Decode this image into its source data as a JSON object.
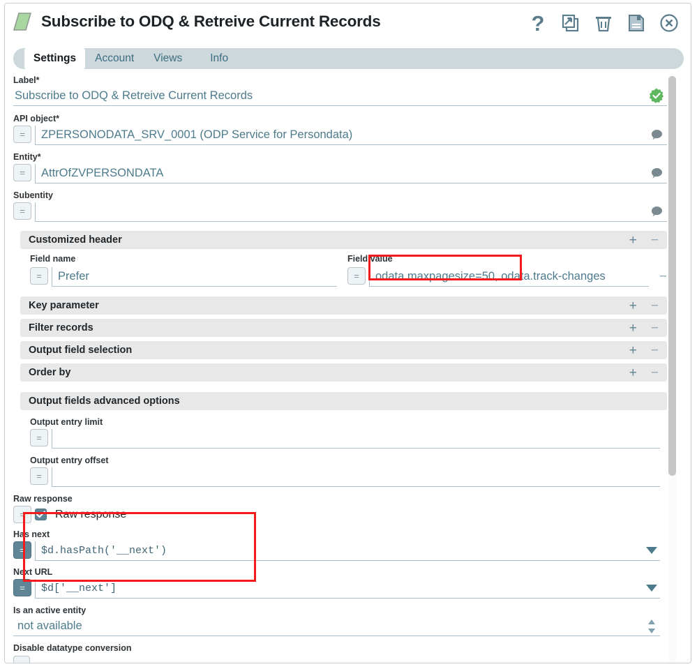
{
  "window": {
    "title": "Subscribe to ODQ & Retreive Current Records",
    "doc_icon": "green-parallelogram-icon",
    "actions": [
      {
        "name": "help-icon",
        "glyph": "?"
      },
      {
        "name": "duplicate-icon",
        "glyph": "duplicate"
      },
      {
        "name": "delete-icon",
        "glyph": "trash"
      },
      {
        "name": "save-icon",
        "glyph": "floppy-disk"
      },
      {
        "name": "close-icon",
        "glyph": "circle-x"
      }
    ]
  },
  "tabs": [
    {
      "label": "Settings",
      "active": true
    },
    {
      "label": "Account",
      "active": false
    },
    {
      "label": "Views",
      "active": false
    },
    {
      "label": "Info",
      "active": false
    }
  ],
  "fields": {
    "label": {
      "caption": "Label*",
      "value": "Subscribe to ODQ & Retreive Current Records",
      "status_icon": "green-check-seal-icon"
    },
    "api_object": {
      "caption": "API object*",
      "value": "ZPERSONODATA_SRV_0001 (ODP Service for Persondata)",
      "eq": "=",
      "side_icon": "comment-bubble-icon"
    },
    "entity": {
      "caption": "Entity*",
      "value": "AttrOfZVPERSONDATA",
      "eq": "=",
      "side_icon": "comment-bubble-icon"
    },
    "subentity": {
      "caption": "Subentity",
      "value": "",
      "eq": "=",
      "side_icon": "comment-bubble-icon"
    },
    "output_entry_limit": {
      "caption": "Output entry limit",
      "value": "",
      "eq": "="
    },
    "output_entry_offset": {
      "caption": "Output entry offset",
      "value": "",
      "eq": "="
    },
    "raw_response": {
      "caption": "Raw response",
      "checkbox_label": "Raw response",
      "checked": true,
      "eq": "="
    },
    "has_next": {
      "caption": "Has next",
      "value": "$d.hasPath('__next')",
      "eq": "=",
      "eq_active": true,
      "dropdown": "chevron-down-icon"
    },
    "next_url": {
      "caption": "Next URL",
      "value": "$d['__next']",
      "eq": "=",
      "eq_active": true,
      "dropdown": "chevron-down-icon"
    },
    "is_active_entity": {
      "caption": "Is an active entity",
      "value": "not available",
      "spinner": "up-down-spinner-icon"
    },
    "disable_datatype_conversion": {
      "caption": "Disable datatype conversion",
      "checked": false
    }
  },
  "customized_header": {
    "title": "Customized header",
    "add_label": "+",
    "remove_label": "−",
    "col_field_name": "Field name",
    "col_field_value": "Field value",
    "rows": [
      {
        "field_name": "Prefer",
        "field_value": "odata.maxpagesize=50, odata.track-changes",
        "eq": "=",
        "row_remove": "−"
      }
    ]
  },
  "collapsed_sections": [
    {
      "title": "Key parameter",
      "add_label": "+",
      "remove_label": "−"
    },
    {
      "title": "Filter records",
      "add_label": "+",
      "remove_label": "−"
    },
    {
      "title": "Output field selection",
      "add_label": "+",
      "remove_label": "−"
    },
    {
      "title": "Order by",
      "add_label": "+",
      "remove_label": "−"
    }
  ],
  "advanced_section": {
    "title": "Output fields advanced options"
  },
  "colors": {
    "accent_blue": "#5f8596",
    "header_gray": "#e8e8e8",
    "tab_strip": "#ccd8dc",
    "value_text": "#4e7b8c",
    "annotation_red": "#f51b1b",
    "doc_icon_green": "#a9d6a0"
  }
}
